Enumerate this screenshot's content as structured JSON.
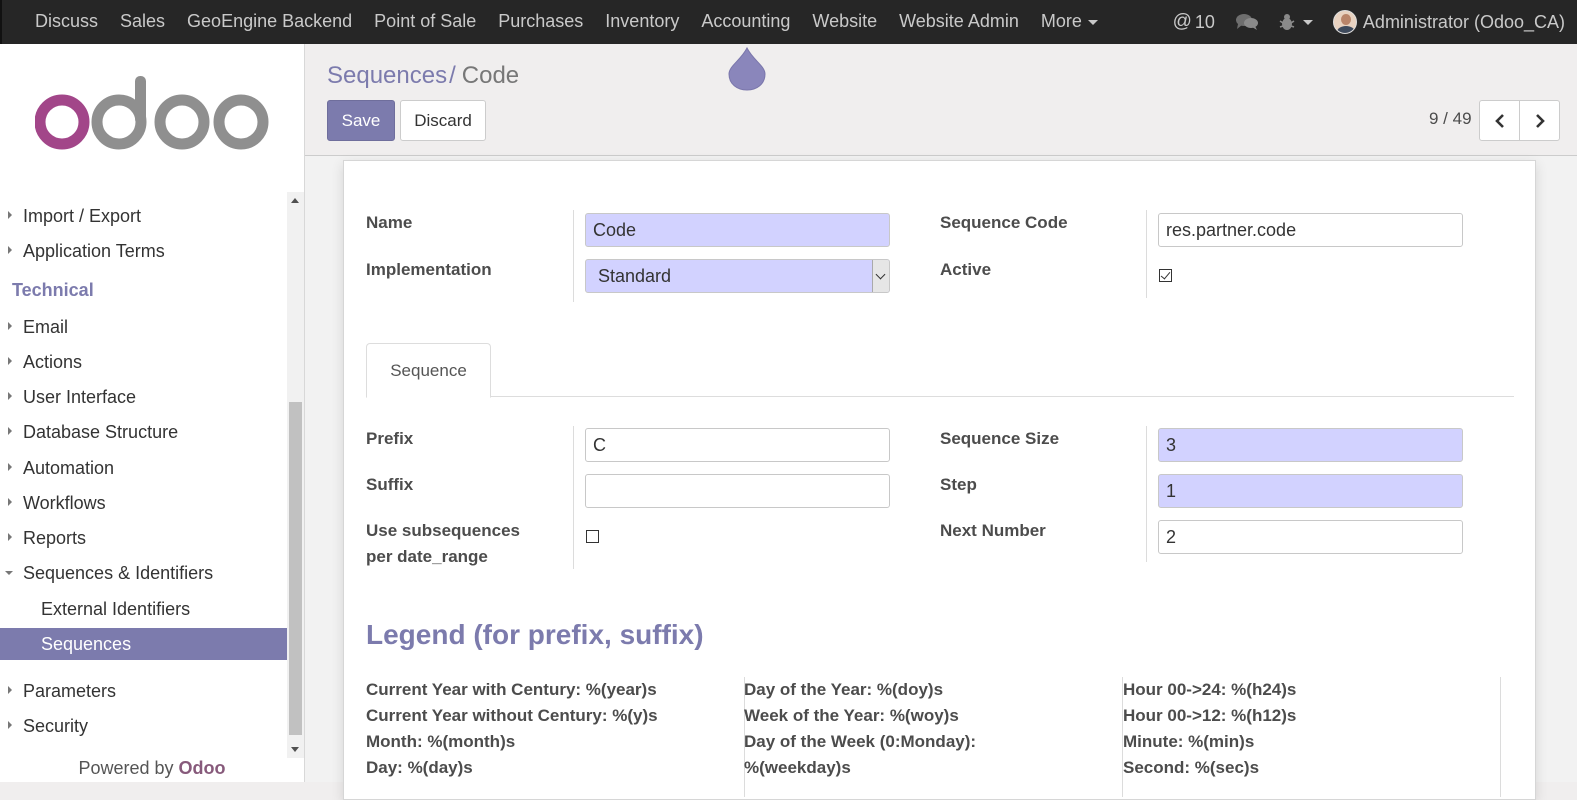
{
  "topnav": {
    "menus": [
      "Discuss",
      "Sales",
      "GeoEngine Backend",
      "Point of Sale",
      "Purchases",
      "Inventory",
      "Accounting",
      "Website",
      "Website Admin"
    ],
    "more_label": "More",
    "mentions_count": "10",
    "user_label": "Administrator (Odoo_CA)"
  },
  "sidebar": {
    "logo_text": "odoo",
    "items_top": [
      "Import / Export",
      "Application Terms"
    ],
    "section_title": "Technical",
    "items": [
      "Email",
      "Actions",
      "User Interface",
      "Database Structure",
      "Automation",
      "Workflows",
      "Reports",
      "Sequences & Identifiers"
    ],
    "subitems": [
      "External Identifiers",
      "Sequences"
    ],
    "items_bottom": [
      "Parameters",
      "Security"
    ],
    "powered_prefix": "Powered by ",
    "powered_brand": "Odoo"
  },
  "control_panel": {
    "breadcrumb_parent": "Sequences",
    "breadcrumb_sep": "/",
    "breadcrumb_current": "Code",
    "save_label": "Save",
    "discard_label": "Discard",
    "pager": "9 / 49"
  },
  "form": {
    "name_label": "Name",
    "name_value": "Code",
    "implementation_label": "Implementation",
    "implementation_value": "Standard",
    "sequence_code_label": "Sequence Code",
    "sequence_code_value": "res.partner.code",
    "active_label": "Active",
    "active_checked": true,
    "tab_label": "Sequence",
    "prefix_label": "Prefix",
    "prefix_value": "C",
    "suffix_label": "Suffix",
    "suffix_value": "",
    "subseq_label_1": "Use subsequences",
    "subseq_label_2": "per date_range",
    "subseq_checked": false,
    "size_label": "Sequence Size",
    "size_value": "3",
    "step_label": "Step",
    "step_value": "1",
    "next_label": "Next Number",
    "next_value": "2"
  },
  "legend": {
    "title": "Legend (for prefix, suffix)",
    "col1": [
      "Current Year with Century: %(year)s",
      "Current Year without Century: %(y)s",
      "Month: %(month)s",
      "Day: %(day)s"
    ],
    "col2": [
      "Day of the Year: %(doy)s",
      "Week of the Year: %(woy)s",
      "Day of the Week (0:Monday):",
      "%(weekday)s"
    ],
    "col3": [
      "Hour 00->24: %(h24)s",
      "Hour 00->12: %(h12)s",
      "Minute: %(min)s",
      "Second: %(sec)s"
    ]
  },
  "colors": {
    "primary": "#7c7bad",
    "navbar": "#262626",
    "required_field": "#d2d2ff",
    "brand": "#875a7b"
  }
}
